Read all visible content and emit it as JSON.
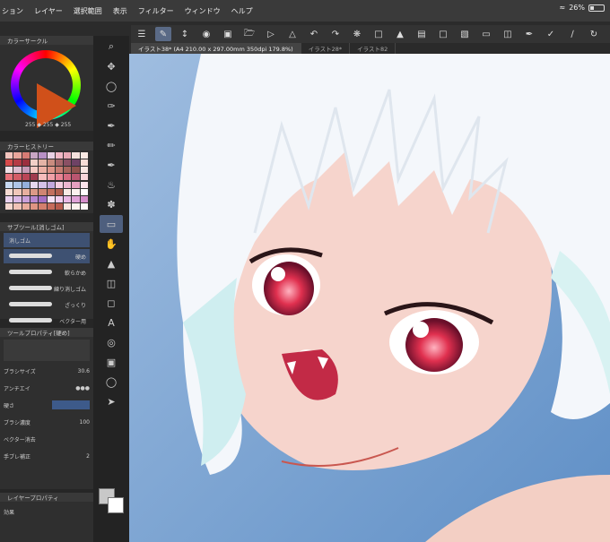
{
  "menu": [
    "ション",
    "レイヤー",
    "選択範囲",
    "表示",
    "フィルター",
    "ウィンドウ",
    "ヘルプ"
  ],
  "status": {
    "battery": "26%"
  },
  "tabs": [
    {
      "label": "イラスト38* (A4 210.00 x 297.00mm 350dpi 179.8%)",
      "active": true
    },
    {
      "label": "イラスト28*",
      "active": false
    },
    {
      "label": "イラスト82",
      "active": false
    }
  ],
  "panels": {
    "color_circle": {
      "title": "カラーサークル",
      "rgb": "255 ◆ 255 ◆ 255"
    },
    "color_history": {
      "title": "カラーヒストリー"
    },
    "subtool": {
      "title": "サブツール[消しゴム]",
      "group": "消しゴム",
      "items": [
        "硬め",
        "軟らかめ",
        "練り消しゴム",
        "ざっくり",
        "ベクター用"
      ]
    },
    "tool_property": {
      "title": "ツールプロパティ[硬め]",
      "brush_size_label": "ブラシサイズ",
      "brush_size_value": "30.6",
      "antialias_label": "アンチエイ",
      "hardness_label": "硬さ",
      "brush_density_label": "ブラシ濃度",
      "brush_density_value": "100",
      "vector_erase_label": "ベクター消去",
      "stabilization_label": "手ブレ補正",
      "stabilization_value": "2"
    },
    "layer_property": {
      "title": "レイヤープロパティ",
      "effect_label": "効果"
    }
  },
  "colors": {
    "accent": "#4e5f7e",
    "swatches": [
      "#f3c4bd",
      "#e9a59b",
      "#d77b74",
      "#c9a6c4",
      "#b890c5",
      "#e8d0e4",
      "#f1b8c6",
      "#e7a8b5",
      "#f4e0dc",
      "#fbe9e4",
      "#d64a4a",
      "#b53a45",
      "#9b2f3e",
      "#f2d0c7",
      "#e4b3a6",
      "#c98c7f",
      "#a5676a",
      "#8a5064",
      "#6e4265",
      "#f6ddd6",
      "#f0e1e6",
      "#ddbcd0",
      "#c899b5",
      "#f5c9c2",
      "#ecb0a5",
      "#de9588",
      "#c77d72",
      "#a8655e",
      "#8f524d",
      "#f8e6e1",
      "#e8727a",
      "#d45c67",
      "#ba4557",
      "#a03b4e",
      "#f6bcbc",
      "#f1a1a8",
      "#ea8493",
      "#d66a80",
      "#b95670",
      "#f9d6da",
      "#c7d9f1",
      "#aec5e7",
      "#94b0dc",
      "#e6d8ef",
      "#d5c1e8",
      "#c2a9dd",
      "#f4cde0",
      "#edb6d0",
      "#e59fc0",
      "#fbe3ec",
      "#f7dcd3",
      "#f0c7b9",
      "#e7b09f",
      "#dc9a87",
      "#d08572",
      "#c2715f",
      "#b0604f",
      "#f9ebe4",
      "#fbf2ee",
      "#ffffff",
      "#ead2ee",
      "#dbb9e5",
      "#caa0da",
      "#b887cf",
      "#a56fc3",
      "#f7e4f6",
      "#f2cfee",
      "#eab9e4",
      "#e0a3d8",
      "#d58ecb",
      "#f5d7cf",
      "#f0c2b6",
      "#e8ab9c",
      "#de9483",
      "#d37f6d",
      "#c66c5b",
      "#b65b4c",
      "#f9e6e0",
      "#fcf1ed",
      "#fff9f7"
    ]
  }
}
